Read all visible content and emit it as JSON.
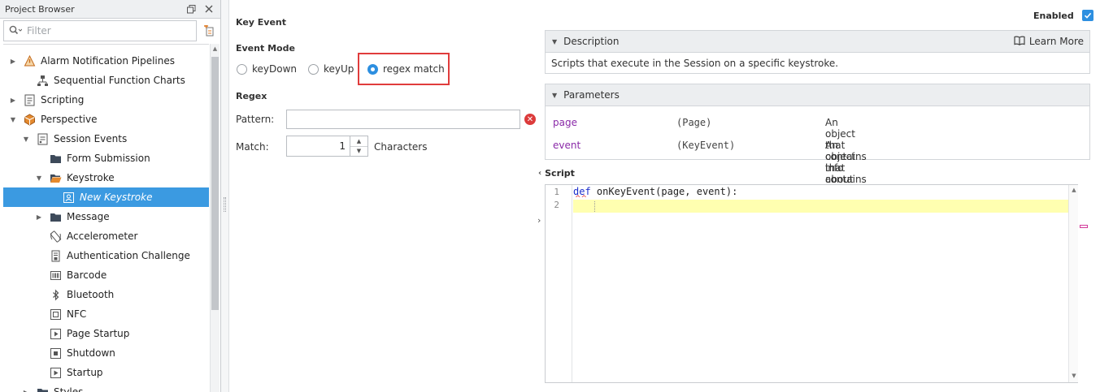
{
  "browser": {
    "title": "Project Browser",
    "filter_placeholder": "Filter",
    "tree": [
      {
        "label": "Alarm Notification Pipelines",
        "toggle": "▶",
        "icon": "alarm-pipeline-icon"
      },
      {
        "label": "Sequential Function Charts",
        "toggle": "",
        "icon": "sfc-icon"
      },
      {
        "label": "Scripting",
        "toggle": "▶",
        "icon": "scripting-icon"
      },
      {
        "label": "Perspective",
        "toggle": "▼",
        "icon": "perspective-icon"
      },
      {
        "label": "Session Events",
        "toggle": "▼",
        "icon": "session-events-icon"
      },
      {
        "label": "Form Submission",
        "toggle": "",
        "icon": "folder-icon"
      },
      {
        "label": "Keystroke",
        "toggle": "▼",
        "icon": "folder-open-icon"
      },
      {
        "label": "New Keystroke",
        "toggle": "",
        "icon": "keystroke-icon"
      },
      {
        "label": "Message",
        "toggle": "▶",
        "icon": "folder-icon"
      },
      {
        "label": "Accelerometer",
        "toggle": "",
        "icon": "accelerometer-icon"
      },
      {
        "label": "Authentication Challenge",
        "toggle": "",
        "icon": "auth-challenge-icon"
      },
      {
        "label": "Barcode",
        "toggle": "",
        "icon": "barcode-icon"
      },
      {
        "label": "Bluetooth",
        "toggle": "",
        "icon": "bluetooth-icon"
      },
      {
        "label": "NFC",
        "toggle": "",
        "icon": "nfc-icon"
      },
      {
        "label": "Page Startup",
        "toggle": "",
        "icon": "page-startup-icon"
      },
      {
        "label": "Shutdown",
        "toggle": "",
        "icon": "shutdown-icon"
      },
      {
        "label": "Startup",
        "toggle": "",
        "icon": "startup-icon"
      },
      {
        "label": "Styles",
        "toggle": "▶",
        "icon": "folder-icon"
      }
    ]
  },
  "settings": {
    "title": "Key Event",
    "event_mode_label": "Event Mode",
    "modes": [
      "keyDown",
      "keyUp",
      "regex match"
    ],
    "selected_mode": "regex match",
    "regex_label": "Regex",
    "pattern_label": "Pattern:",
    "pattern_value": "",
    "match_label": "Match:",
    "match_value": "1",
    "characters_label": "Characters"
  },
  "enabled": {
    "label": "Enabled",
    "checked": true
  },
  "description": {
    "header": "Description",
    "learn_more": "Learn More",
    "text": "Scripts that execute in the Session on a specific keystroke."
  },
  "parameters": {
    "header": "Parameters",
    "rows": [
      {
        "name": "page",
        "type": "(Page)",
        "desc": "An object that contains info about the current page."
      },
      {
        "name": "event",
        "type": "(KeyEvent)",
        "desc": "An object that contains info from the Key Event"
      }
    ]
  },
  "script": {
    "label": "Script",
    "line_numbers": [
      "1",
      "2"
    ],
    "keyword": "def",
    "signature": " onKeyEvent(page, event):"
  },
  "colors": {
    "selection": "#3b9ae1",
    "accent": "#2d8fe0",
    "highlight_border": "#e03c3c",
    "param_name": "#8a2aa8",
    "active_line": "#ffffb0"
  }
}
